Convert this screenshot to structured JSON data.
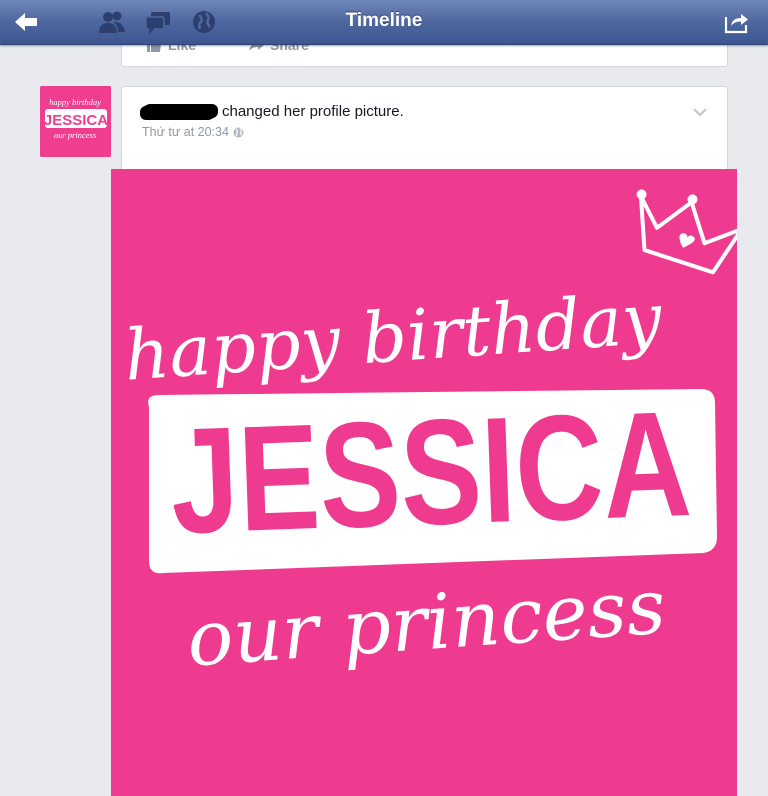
{
  "navbar": {
    "title": "Timeline",
    "icons": [
      "back-arrow-icon",
      "friends-icon",
      "messages-icon",
      "globe-icon",
      "share-icon"
    ],
    "bar_color": "#4e679f"
  },
  "previous_post": {
    "like_label": "Like",
    "share_label": "Share"
  },
  "post": {
    "author_redacted": true,
    "action_text": "changed her profile picture.",
    "timestamp": "Thứ tư at 20:34",
    "privacy_icon": "globe-icon",
    "menu_icon": "chevron-down-icon"
  },
  "photo": {
    "line1": "happy birthday",
    "name": "JESSICA",
    "line3": "our princess",
    "background_color": "#ee3b8f"
  },
  "avatar": {
    "line1": "happy birthday",
    "name": "JESSICA",
    "line3": "our princess"
  }
}
